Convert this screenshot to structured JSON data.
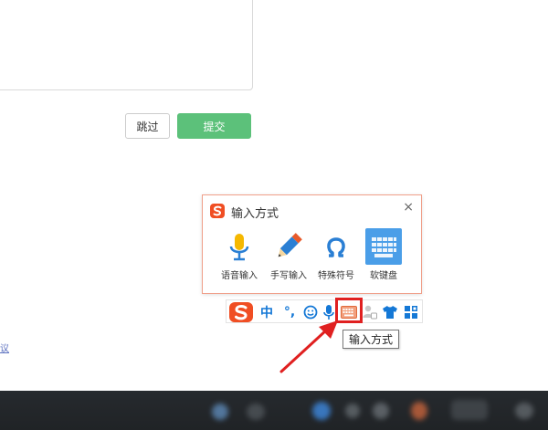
{
  "form": {
    "skip_label": "跳过",
    "submit_label": "提交",
    "submit_color": "#5cc17a"
  },
  "ime_panel": {
    "title": "输入方式",
    "close_symbol": "×",
    "border_color": "#f0a08a",
    "tools": [
      {
        "label": "语音输入",
        "icon": "microphone-icon"
      },
      {
        "label": "手写输入",
        "icon": "pencil-icon"
      },
      {
        "label": "特殊符号",
        "icon": "omega-icon"
      },
      {
        "label": "软键盘",
        "icon": "keyboard-icon",
        "active": true
      }
    ]
  },
  "toolbar": {
    "logo_icon": "sogou-logo-icon",
    "chinese_mode": "中",
    "punctuation": "°,",
    "items": [
      "emoji-icon",
      "microphone-icon",
      "keyboard-icon",
      "user-icon",
      "skin-icon",
      "toolbox-icon"
    ]
  },
  "tooltip": {
    "text": "输入方式"
  },
  "link": {
    "text": "议"
  },
  "annotation_color": "#e02020"
}
